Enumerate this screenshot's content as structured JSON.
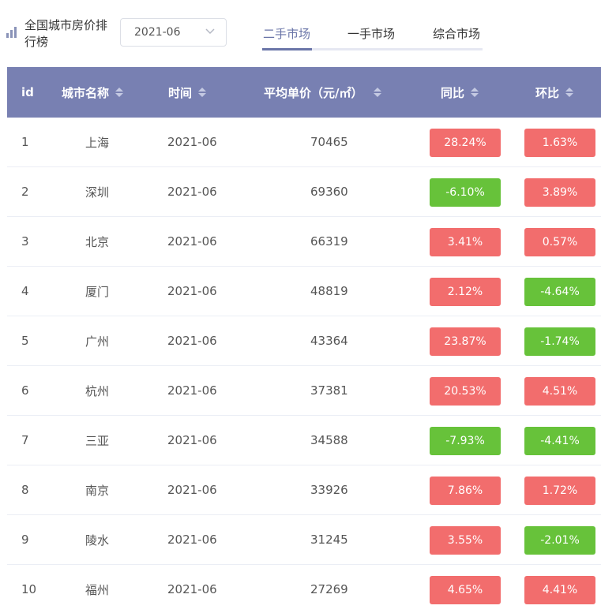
{
  "header": {
    "title": "全国城市房价排行榜",
    "title_icon": "bar-chart-icon",
    "date_select": {
      "value": "2021-06",
      "icon": "chevron-down-icon"
    }
  },
  "tabs": [
    {
      "label": "二手市场",
      "active": true
    },
    {
      "label": "一手市场",
      "active": false
    },
    {
      "label": "综合市场",
      "active": false
    }
  ],
  "table": {
    "columns": {
      "id": "id",
      "city": "城市名称",
      "time": "时间",
      "price": "平均单价（元/㎡）",
      "yoy": "同比",
      "mom": "环比"
    },
    "rows": [
      {
        "id": "1",
        "city": "上海",
        "time": "2021-06",
        "price": "70465",
        "yoy": "28.24%",
        "mom": "1.63%"
      },
      {
        "id": "2",
        "city": "深圳",
        "time": "2021-06",
        "price": "69360",
        "yoy": "-6.10%",
        "mom": "3.89%"
      },
      {
        "id": "3",
        "city": "北京",
        "time": "2021-06",
        "price": "66319",
        "yoy": "3.41%",
        "mom": "0.57%"
      },
      {
        "id": "4",
        "city": "厦门",
        "time": "2021-06",
        "price": "48819",
        "yoy": "2.12%",
        "mom": "-4.64%"
      },
      {
        "id": "5",
        "city": "广州",
        "time": "2021-06",
        "price": "43364",
        "yoy": "23.87%",
        "mom": "-1.74%"
      },
      {
        "id": "6",
        "city": "杭州",
        "time": "2021-06",
        "price": "37381",
        "yoy": "20.53%",
        "mom": "4.51%"
      },
      {
        "id": "7",
        "city": "三亚",
        "time": "2021-06",
        "price": "34588",
        "yoy": "-7.93%",
        "mom": "-4.41%"
      },
      {
        "id": "8",
        "city": "南京",
        "time": "2021-06",
        "price": "33926",
        "yoy": "7.86%",
        "mom": "1.72%"
      },
      {
        "id": "9",
        "city": "陵水",
        "time": "2021-06",
        "price": "31245",
        "yoy": "3.55%",
        "mom": "-2.01%"
      },
      {
        "id": "10",
        "city": "福州",
        "time": "2021-06",
        "price": "27269",
        "yoy": "4.65%",
        "mom": "4.41%"
      }
    ]
  },
  "colors": {
    "header_bg": "#7880b2",
    "accent": "#6a75a8",
    "positive": "#f26d6d",
    "negative": "#67c23a"
  }
}
